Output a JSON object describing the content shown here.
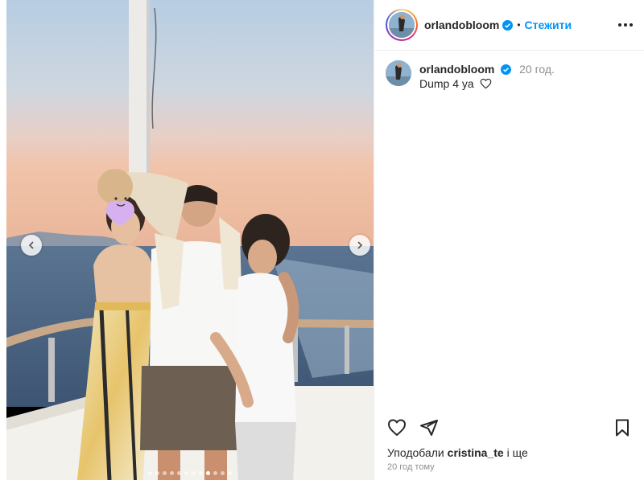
{
  "post": {
    "author": {
      "username": "orlandobloom",
      "verified": true,
      "follow_label": "Стежити",
      "separator": "•"
    },
    "caption": {
      "username": "orlandobloom",
      "time": "20 год.",
      "text": "Dump 4 ya"
    },
    "actions": {
      "icons": [
        "heart-icon",
        "send-icon",
        "bookmark-icon"
      ]
    },
    "likes": {
      "prefix": "Уподобали ",
      "user": "cristina_te",
      "suffix": " і ще"
    },
    "posted_ago": "20 год тому",
    "carousel": {
      "total_slides": 12,
      "active_index": 8
    }
  },
  "colors": {
    "follow": "#0095f6",
    "text": "#262626",
    "muted": "#8e8e8e",
    "verified": "#0095f6"
  }
}
